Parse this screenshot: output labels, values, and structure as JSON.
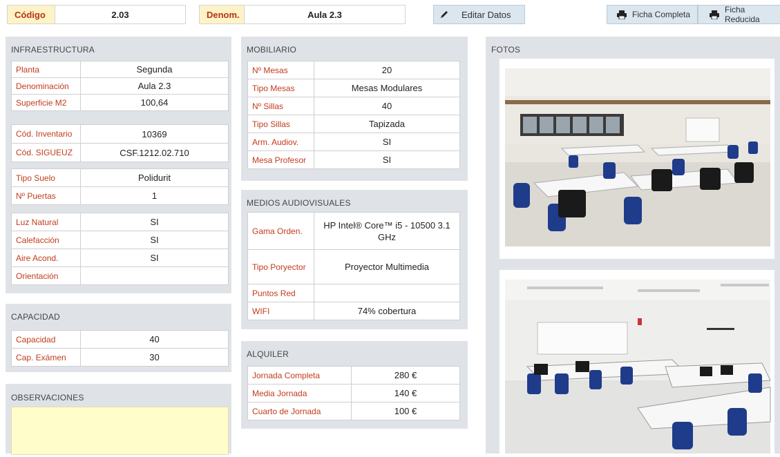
{
  "header": {
    "codigo_label": "Código",
    "codigo_value": "2.03",
    "denom_label": "Denom.",
    "denom_value": "Aula 2.3",
    "edit_label": "Editar Datos",
    "ficha_completa_label": "Ficha Completa",
    "ficha_reducida_label": "Ficha Reducida"
  },
  "infraestructura": {
    "title": "INFRAESTRUCTURA",
    "group1": [
      {
        "label": "Planta",
        "value": "Segunda"
      },
      {
        "label": "Denominación",
        "value": "Aula 2.3"
      },
      {
        "label": "Superficie M2",
        "value": "100,64"
      }
    ],
    "group2": [
      {
        "label": "Cód. Inventario",
        "value": "10369"
      },
      {
        "label": "Cód. SIGUEUZ",
        "value": "CSF.1212.02.710"
      }
    ],
    "group3": [
      {
        "label": "Tipo Suelo",
        "value": "Polidurit"
      },
      {
        "label": "Nº Puertas",
        "value": "1"
      }
    ],
    "group4": [
      {
        "label": "Luz Natural",
        "value": "SI"
      },
      {
        "label": "Calefacción",
        "value": "SI"
      },
      {
        "label": "Aire Acond.",
        "value": "SI"
      },
      {
        "label": "Orientación",
        "value": ""
      }
    ]
  },
  "capacidad": {
    "title": "CAPACIDAD",
    "rows": [
      {
        "label": "Capacidad",
        "value": "40"
      },
      {
        "label": "Cap. Exámen",
        "value": "30"
      }
    ]
  },
  "observaciones": {
    "title": "OBSERVACIONES",
    "text": ""
  },
  "mobiliario": {
    "title": "MOBILIARIO",
    "rows": [
      {
        "label": "Nº Mesas",
        "value": "20"
      },
      {
        "label": "Tipo Mesas",
        "value": "Mesas Modulares"
      },
      {
        "label": "Nº Sillas",
        "value": "40"
      },
      {
        "label": "Tipo Sillas",
        "value": "Tapizada"
      },
      {
        "label": "Arm. Audiov.",
        "value": "SI"
      },
      {
        "label": "Mesa Profesor",
        "value": "SI"
      }
    ]
  },
  "medios": {
    "title": "MEDIOS AUDIOVISUALES",
    "rows": [
      {
        "label": "Gama Orden.",
        "value": "HP Intel® Core™ i5 - 10500 3.1 GHz"
      },
      {
        "label": "Tipo Poryector",
        "value": "Proyector Multimedia"
      },
      {
        "label": "Puntos Red",
        "value": ""
      },
      {
        "label": "WIFI",
        "value": "74% cobertura"
      }
    ]
  },
  "alquiler": {
    "title": "ALQUILER",
    "rows": [
      {
        "label": "Jornada Completa",
        "value": "280 €"
      },
      {
        "label": "Media Jornada",
        "value": "140 €"
      },
      {
        "label": "Cuarto de Jornada",
        "value": "100 €"
      }
    ]
  },
  "fotos": {
    "title": "FOTOS"
  },
  "icons": {
    "edit": "pencil-icon",
    "print": "printer-icon"
  },
  "colors": {
    "label_red": "#c23b1b",
    "header_yellow": "#fdf3c6",
    "panel_gray": "#dfe3e8",
    "button_blue": "#dbe6ee",
    "obs_yellow": "#fffdc9"
  }
}
